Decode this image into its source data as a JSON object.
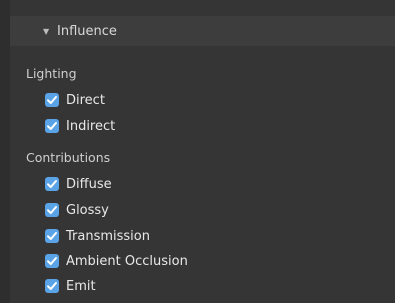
{
  "panel": {
    "header": {
      "title": "Influence",
      "expanded": true,
      "arrow_icon": "disclosure-triangle-down-icon"
    },
    "sections": [
      {
        "label": "Lighting",
        "items": [
          {
            "label": "Direct",
            "checked": true
          },
          {
            "label": "Indirect",
            "checked": true
          }
        ]
      },
      {
        "label": "Contributions",
        "items": [
          {
            "label": "Diffuse",
            "checked": true
          },
          {
            "label": "Glossy",
            "checked": true
          },
          {
            "label": "Transmission",
            "checked": true
          },
          {
            "label": "Ambient Occlusion",
            "checked": true
          },
          {
            "label": "Emit",
            "checked": true
          }
        ]
      }
    ]
  },
  "colors": {
    "background": "#2e2e2e",
    "panel": "#353535",
    "header": "#3d3d3d",
    "checkbox_accent": "#5aa3e6",
    "text": "#e6e6e6"
  }
}
